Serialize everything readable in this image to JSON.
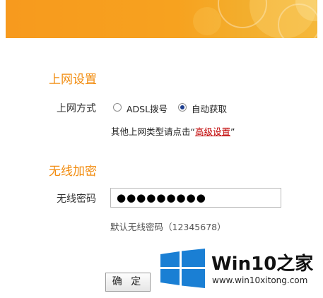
{
  "wan_section": {
    "title": "上网设置",
    "mode_label": "上网方式",
    "options": [
      {
        "label": "ADSL拨号",
        "checked": false
      },
      {
        "label": "自动获取",
        "checked": true
      }
    ],
    "hint_prefix": "其他上网类型请点击“",
    "hint_link": "高级设置",
    "hint_suffix": "”"
  },
  "wireless_section": {
    "title": "无线加密",
    "password_label": "无线密码",
    "password_value": "●●●●●●●●●",
    "default_password_text": "默认无线密码（12345678）"
  },
  "confirm_button": "确 定",
  "watermark": {
    "title": "Win10之家",
    "url": "www.win10xitong.com"
  },
  "colors": {
    "banner": "#f79a1e",
    "section_title": "#f28c0f",
    "link": "#c00000",
    "logo": "#1a7fd4"
  }
}
